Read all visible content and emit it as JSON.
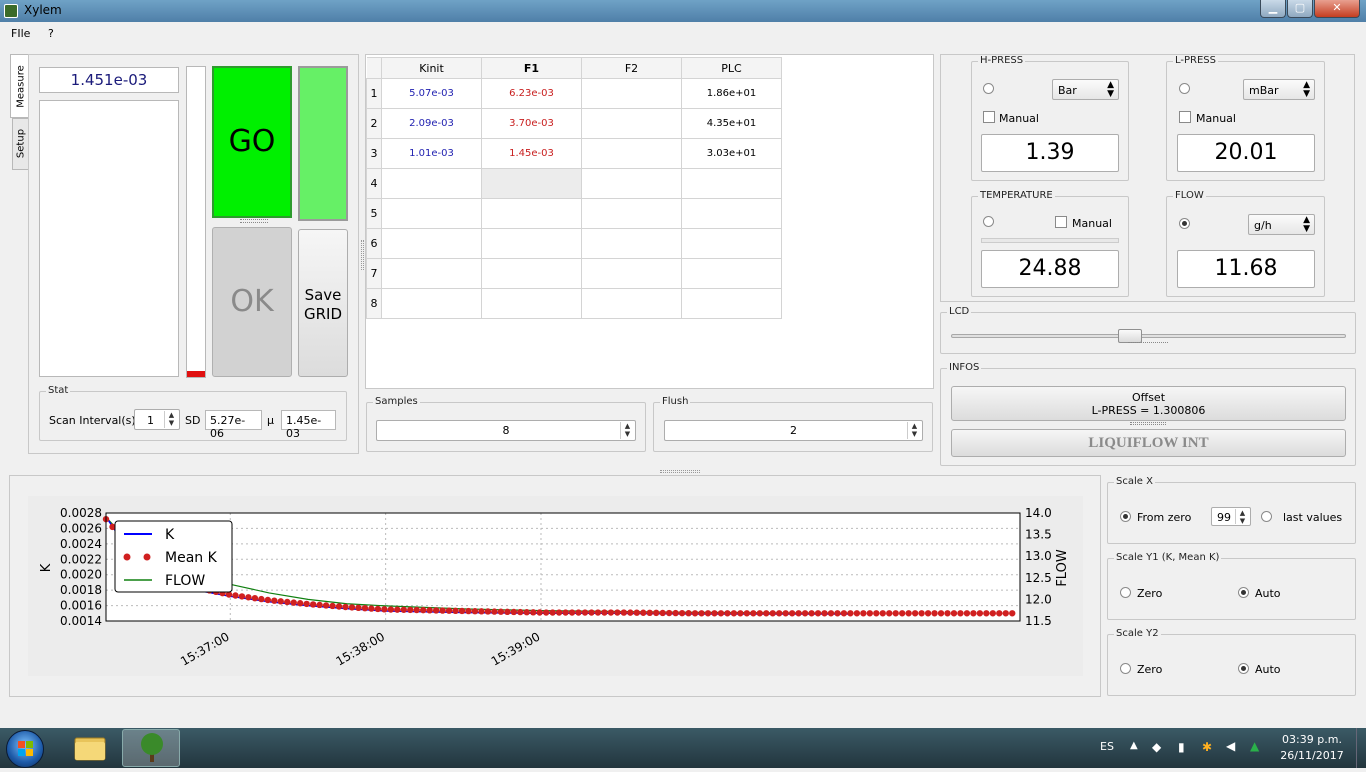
{
  "window": {
    "title": "Xylem"
  },
  "menu": {
    "file": "FIle",
    "help": "?"
  },
  "tabs": {
    "measure": "Measure",
    "setup": "Setup"
  },
  "measure": {
    "current_value": "1.451e-03",
    "go_label": "GO",
    "ok_label": "OK",
    "save_grid_line1": "Save",
    "save_grid_line2": "GRID"
  },
  "stat": {
    "title": "Stat",
    "scan_interval_label": "Scan Interval(s)",
    "scan_interval_value": "1",
    "sd_label": "SD",
    "sd_value": "5.27e-06",
    "mu_label": "µ",
    "mu_value": "1.45e-03"
  },
  "grid": {
    "columns": [
      "Kinit",
      "F1",
      "F2",
      "PLC"
    ],
    "rows": [
      {
        "n": "1",
        "kinit": "5.07e-03",
        "f1": "6.23e-03",
        "f2": "",
        "plc": "1.86e+01"
      },
      {
        "n": "2",
        "kinit": "2.09e-03",
        "f1": "3.70e-03",
        "f2": "",
        "plc": "4.35e+01"
      },
      {
        "n": "3",
        "kinit": "1.01e-03",
        "f1": "1.45e-03",
        "f2": "",
        "plc": "3.03e+01"
      },
      {
        "n": "4",
        "kinit": "",
        "f1": "",
        "f2": "",
        "plc": ""
      },
      {
        "n": "5",
        "kinit": "",
        "f1": "",
        "f2": "",
        "plc": ""
      },
      {
        "n": "6",
        "kinit": "",
        "f1": "",
        "f2": "",
        "plc": ""
      },
      {
        "n": "7",
        "kinit": "",
        "f1": "",
        "f2": "",
        "plc": ""
      },
      {
        "n": "8",
        "kinit": "",
        "f1": "",
        "f2": "",
        "plc": ""
      }
    ]
  },
  "samples": {
    "title": "Samples",
    "value": "8"
  },
  "flush": {
    "title": "Flush",
    "value": "2"
  },
  "hpress": {
    "title": "H-PRESS",
    "unit": "Bar",
    "manual_label": "Manual",
    "value": "1.39"
  },
  "lpress": {
    "title": "L-PRESS",
    "unit": "mBar",
    "manual_label": "Manual",
    "value": "20.01"
  },
  "temperature": {
    "title": "TEMPERATURE",
    "manual_label": "Manual",
    "value": "24.88"
  },
  "flow": {
    "title": "FLOW",
    "unit": "g/h",
    "value": "11.68"
  },
  "lcd": {
    "title": "LCD",
    "slider_level": 0.45
  },
  "infos": {
    "title": "INFOS",
    "offset_line1": "Offset",
    "offset_line2": "L-PRESS = 1.300806",
    "liquiflow_label": "LIQUIFLOW INT"
  },
  "scale_x": {
    "title": "Scale X",
    "from_zero_label": "From zero",
    "count": "99",
    "last_values_label": "last values"
  },
  "scale_y1": {
    "title": "Scale Y1 (K, Mean K)",
    "zero_label": "Zero",
    "auto_label": "Auto"
  },
  "scale_y2": {
    "title": "Scale Y2",
    "zero_label": "Zero",
    "auto_label": "Auto"
  },
  "taskbar": {
    "lang": "ES",
    "time": "03:39 p.m.",
    "date": "26/11/2017"
  },
  "chart_data": {
    "type": "line",
    "xlabel": "",
    "ylabel": "K",
    "y2label": "FLOW",
    "x_ticks": [
      "15:37:00",
      "15:38:00",
      "15:39:00"
    ],
    "y_ticks": [
      "0.0028",
      "0.0026",
      "0.0024",
      "0.0022",
      "0.0020",
      "0.0018",
      "0.0016",
      "0.0014"
    ],
    "y2_ticks": [
      "14.0",
      "13.5",
      "13.0",
      "12.5",
      "12.0",
      "11.5"
    ],
    "ylim": [
      0.0014,
      0.0028
    ],
    "y2lim": [
      11.5,
      14.0
    ],
    "grid": true,
    "legend": "top-left",
    "legend_entries": [
      "K",
      "Mean K",
      "FLOW"
    ],
    "colors": {
      "k": "#0000ff",
      "mean_k": "#d02020",
      "flow": "#108010"
    },
    "x_seconds_from_first_tick": [
      -48,
      -40,
      -30,
      -20,
      -10,
      0,
      15,
      30,
      45,
      60,
      90,
      120,
      150,
      180,
      210,
      240
    ],
    "series": [
      {
        "name": "K",
        "values": [
          0.00275,
          0.00235,
          0.00205,
          0.00188,
          0.00178,
          0.00172,
          0.00165,
          0.0016,
          0.00156,
          0.00153,
          0.00151,
          0.0015,
          0.0015,
          0.00149,
          0.00149,
          0.00149
        ]
      },
      {
        "name": "Mean K",
        "values": [
          0.00272,
          0.0024,
          0.0021,
          0.00192,
          0.00181,
          0.00174,
          0.00167,
          0.00162,
          0.00158,
          0.00155,
          0.00153,
          0.00151,
          0.00151,
          0.0015,
          0.0015,
          0.0015
        ]
      },
      {
        "name": "FLOW",
        "values": [
          13.9,
          13.4,
          13.0,
          12.7,
          12.5,
          12.35,
          12.15,
          12.0,
          11.9,
          11.85,
          11.78,
          11.74,
          11.72,
          11.7,
          11.69,
          11.68
        ]
      }
    ]
  }
}
